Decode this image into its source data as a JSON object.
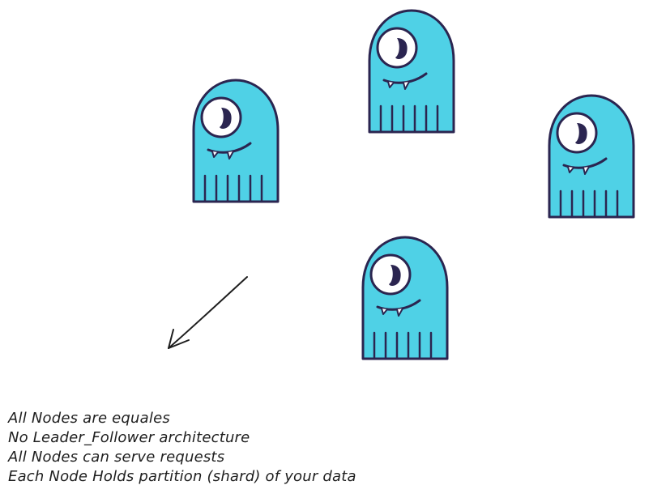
{
  "colors": {
    "mascot_body": "#4fd1e6",
    "mascot_outline": "#2b2550",
    "eye_white": "#ffffff",
    "pupil": "#2b2550",
    "stroke": "#1e1e1e",
    "background": "#ffffff"
  },
  "nodes": [
    {
      "name": "node-top",
      "icon": "scylla-mascot-icon"
    },
    {
      "name": "node-left",
      "icon": "scylla-mascot-icon"
    },
    {
      "name": "node-right",
      "icon": "scylla-mascot-icon"
    },
    {
      "name": "node-bottom",
      "icon": "scylla-mascot-icon"
    }
  ],
  "arrow": {
    "icon": "arrow-down-left-icon"
  },
  "notes": [
    "All Nodes are equales",
    "No Leader_Follower architecture",
    "All Nodes can serve requests",
    "Each Node Holds partition (shard) of your data"
  ]
}
